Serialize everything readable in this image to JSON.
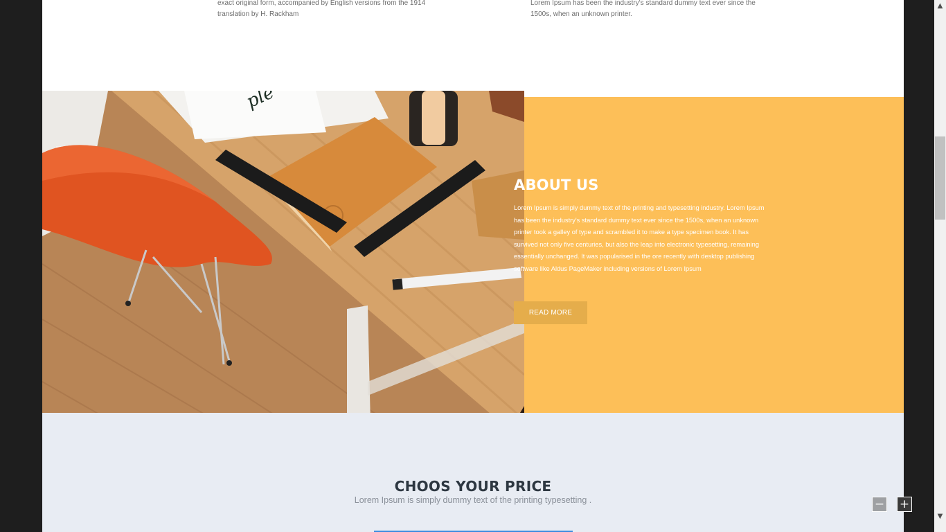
{
  "top_columns": {
    "left_text": "exact original form, accompanied by English versions from the 1914 translation by H. Rackham",
    "right_text": "Lorem Ipsum has been the industry's standard dummy text ever since the 1500s, when an unknown printer."
  },
  "about": {
    "title": "ABOUT US",
    "text": "Lorem Ipsum is simply dummy text of the printing and typesetting industry. Lorem Ipsum has been the industry's standard dummy text ever since the 1500s, when an unknown printer took a galley of type and scrambled it to make a type specimen book. It has survived not only five centuries, but also the leap into electronic typesetting, remaining essentially unchanged. It was popularised in the ore recently with desktop publishing software like Aldus PageMaker including versions of Lorem Ipsum",
    "button_label": "READ MORE",
    "accent_color": "#fdbf58",
    "button_color": "#e5ad4b"
  },
  "pricing": {
    "title": "CHOOS YOUR PRICE",
    "subtitle": "Lorem Ipsum is simply dummy text of the printing typesetting ."
  },
  "zoom_controls": {
    "zoom_out_label": "−",
    "zoom_in_label": "+"
  },
  "scrollbar": {
    "up_icon": "▲",
    "down_icon": "▼"
  },
  "icons": {
    "zoom_out": "minus-icon",
    "zoom_in": "plus-icon"
  }
}
